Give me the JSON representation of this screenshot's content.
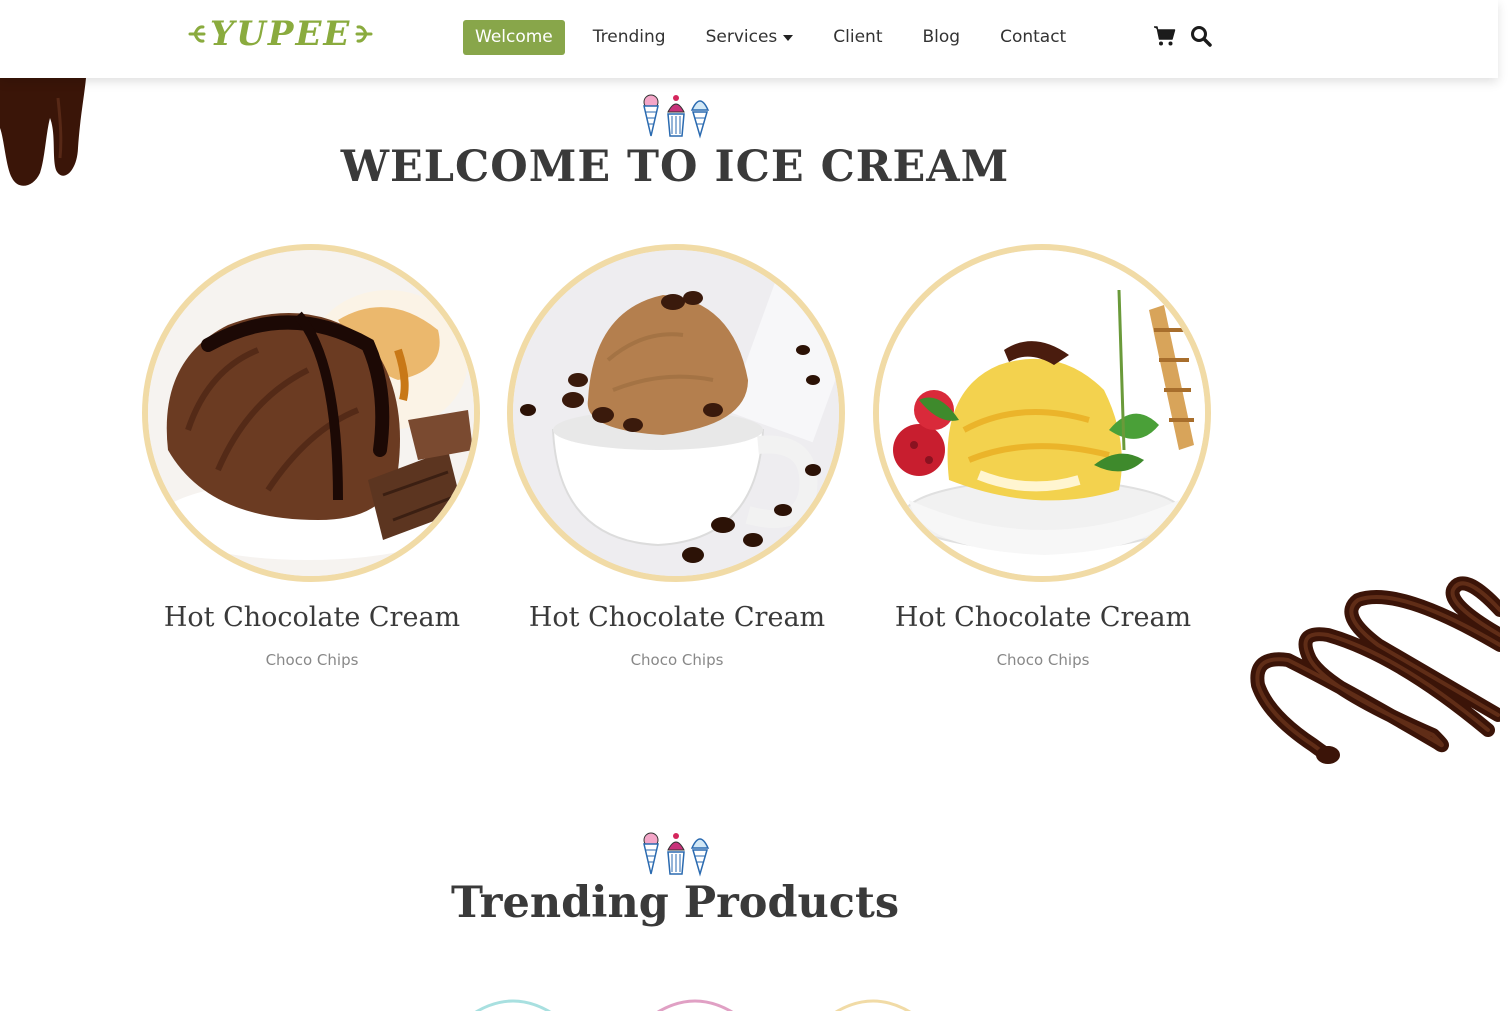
{
  "brand": {
    "logo_text": "YUPEE",
    "accent": "#88a64a"
  },
  "nav": {
    "items": [
      {
        "label": "Welcome",
        "active": true
      },
      {
        "label": "Trending"
      },
      {
        "label": "Services",
        "dropdown": true
      },
      {
        "label": "Client"
      },
      {
        "label": "Blog"
      },
      {
        "label": "Contact"
      }
    ],
    "icons": [
      "cart-icon",
      "search-icon"
    ]
  },
  "welcome": {
    "title": "WELCOME TO ICE CREAM",
    "cards": [
      {
        "title": "Hot Chocolate Cream",
        "subtitle": "Choco Chips"
      },
      {
        "title": "Hot Chocolate Cream",
        "subtitle": "Choco Chips"
      },
      {
        "title": "Hot Chocolate Cream",
        "subtitle": "Choco Chips"
      }
    ]
  },
  "trending": {
    "title": "Trending Products"
  },
  "colors": {
    "circle_border": "#f1dba6",
    "chocolate": "#3d1a0c"
  }
}
